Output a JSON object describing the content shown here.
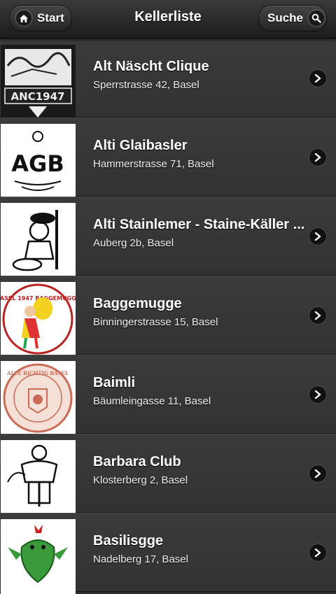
{
  "header": {
    "title": "Kellerliste",
    "start_label": "Start",
    "search_label": "Suche",
    "start_icon": "home-icon",
    "search_icon": "search-icon"
  },
  "items": [
    {
      "name": "Alt Näscht Clique",
      "address": "Sperrstrasse 42, Basel",
      "logo_text": "ANC1947"
    },
    {
      "name": "Alti Glaibasler",
      "address": "Hammerstrasse 71, Basel",
      "logo_text": "AGB"
    },
    {
      "name": "Alti Stainlemer - Staine-Käller ...",
      "address": "Auberg 2b, Basel",
      "logo_text": ""
    },
    {
      "name": "Baggemugge",
      "address": "Binningerstrasse 15, Basel",
      "logo_text": "BASEL 1947 BAGGEMUGGE"
    },
    {
      "name": "Baimli",
      "address": "Bäumleingasse 11, Basel",
      "logo_text": "ALLE RICHTIG BASEL"
    },
    {
      "name": "Barbara Club",
      "address": "Klosterberg 2, Basel",
      "logo_text": ""
    },
    {
      "name": "Basilisgge",
      "address": "Nadelberg 17, Basel",
      "logo_text": ""
    }
  ],
  "colors": {
    "background": "#2e2e2e",
    "header": "#1c1c1c",
    "row": "#363636"
  }
}
